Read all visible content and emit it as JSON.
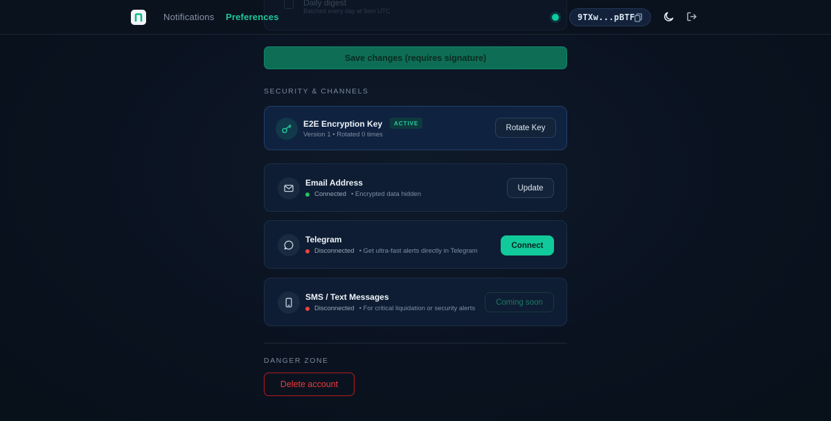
{
  "header": {
    "nav": [
      {
        "label": "Notifications",
        "active": false
      },
      {
        "label": "Preferences",
        "active": true
      }
    ],
    "ghost": {
      "title": "Daily digest",
      "subtitle": "Batched every day at 9am UTC"
    },
    "wallet": "9TXw...pBTF",
    "icons": [
      "logo-icon",
      "status-dot",
      "copy-icon",
      "moon-icon",
      "logout-icon"
    ]
  },
  "save_button": "Save changes (requires signature)",
  "security_title": "SECURITY & CHANNELS",
  "encryption": {
    "title": "E2E Encryption Key",
    "badge": "ACTIVE",
    "subtitle": "Version 1 • Rotated 0 times",
    "button": "Rotate Key",
    "icon": "key-icon"
  },
  "channels": [
    {
      "title": "Email Address",
      "status": "Connected",
      "status_color": "#22c55e",
      "note": "• Encrypted data hidden",
      "button": "Update",
      "icon": "mail-icon"
    },
    {
      "title": "Telegram",
      "status": "Disconnected",
      "status_color": "#ef4444",
      "note": "• Get ultra-fast alerts directly in Telegram",
      "button": "Connect",
      "icon": "chat-bubble-icon"
    },
    {
      "title": "SMS / Text Messages",
      "status": "Disconnected",
      "status_color": "#ef4444",
      "note": "• For critical liquidation or security alerts",
      "button": "Coming soon",
      "icon": "phone-icon"
    }
  ],
  "danger_title": "DANGER ZONE",
  "delete_button": "Delete account",
  "colors": {
    "accent": "#11c99a",
    "danger": "#ef3a3a",
    "background": "#0a1220"
  }
}
